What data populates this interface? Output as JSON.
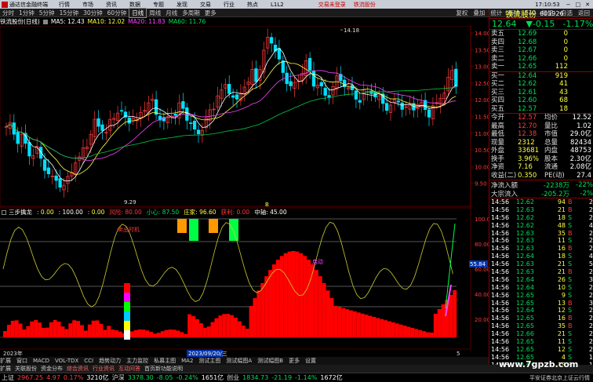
{
  "titlebar": {
    "app_title": "通达信金融终端",
    "menu": [
      "行情",
      "市场",
      "资讯",
      "数据",
      "专题",
      "发现",
      "交易",
      "行业",
      "热点",
      "L1L2"
    ],
    "center_links": [
      "交易未登录",
      "铁流股份"
    ],
    "window_controls": [
      "−",
      "□",
      "✕"
    ]
  },
  "periodbar": {
    "periods": [
      "分时",
      "1分钟",
      "5分钟",
      "15分钟",
      "30分钟",
      "60分钟",
      "日线",
      "周线",
      "月线",
      "多周期",
      "更多"
    ],
    "active_period": "日线",
    "right_tools": [
      "复权",
      "叠加",
      "统计",
      "画线",
      "F10",
      "标记",
      "-自选",
      "返回"
    ]
  },
  "stockline": {
    "name": "铁流股份(日线)",
    "ma5": "MA5: 12.43",
    "ma10": "MA10: 12.02",
    "ma20": "MA20: 11.83",
    "ma60": "MA60: 11.76"
  },
  "price_chart": {
    "high_label": "14.18",
    "low_label": "9.29",
    "right_axis": [
      "14.00",
      "13.50",
      "13.00",
      "12.50",
      "12.00",
      "11.50",
      "11.00",
      "10.50",
      "10.00",
      "9.50"
    ],
    "x_marker": "B"
  },
  "indicator": {
    "name": "三步擒龙",
    "vals": [
      ": 0.00",
      ": 100.00",
      ": 0.00",
      "风险: 80.00",
      "小心: 87.50",
      "庄家: 96.60",
      "获利: 0.00",
      "中轴: 45.00"
    ],
    "annotation_top": "卖出时机",
    "annotation_mid": "启动",
    "value_tag": "55.84",
    "right_axis": [
      "100.00",
      "80.00",
      "60.00",
      "40.00",
      "20.00"
    ]
  },
  "xaxis": {
    "left_date": "2023年",
    "cursor_date": "2023/09/20/三",
    "right_mark": "5"
  },
  "tabs": [
    "扩展",
    "窗口",
    "MACD",
    "VOL-TDX",
    "CCI",
    "趋势动力",
    "主力监控",
    "私募主图",
    "MA2",
    "测试主图",
    "测试幅图A",
    "测试幅图B",
    "更多",
    "设置"
  ],
  "tabs2": [
    "扩展",
    "关联股份",
    "资金分布",
    "综合资讯",
    "行业资讯",
    "互动问答",
    "首页新功能说明"
  ],
  "quote": {
    "name": "铁流股份",
    "code": "603926",
    "price": "12.64",
    "change": "▼-0.15",
    "pct": "-1.17%",
    "asks": [
      {
        "label": "卖五",
        "price": "12.69",
        "vol": "0"
      },
      {
        "label": "卖四",
        "price": "12.68",
        "vol": "0"
      },
      {
        "label": "卖三",
        "price": "12.67",
        "vol": "0"
      },
      {
        "label": "卖二",
        "price": "12.66",
        "vol": "0"
      },
      {
        "label": "卖一",
        "price": "12.65",
        "vol": "112"
      }
    ],
    "bids": [
      {
        "label": "买一",
        "price": "12.64",
        "vol": "919"
      },
      {
        "label": "买二",
        "price": "12.62",
        "vol": "41"
      },
      {
        "label": "买三",
        "price": "12.61",
        "vol": "43"
      },
      {
        "label": "买四",
        "price": "12.60",
        "vol": "68"
      },
      {
        "label": "买五",
        "price": "12.57",
        "vol": "18"
      }
    ],
    "stats": [
      [
        "今开",
        "12.57",
        "均价",
        "12.52"
      ],
      [
        "最高",
        "12.70",
        "量比",
        "1.02"
      ],
      [
        "最低",
        "12.38",
        "市值",
        "29.0亿"
      ],
      [
        "现量",
        "2312",
        "总量",
        "82434"
      ],
      [
        "外盘",
        "33681",
        "内盘",
        "48753"
      ],
      [
        "换手",
        "3.96%",
        "股本",
        "2.30亿"
      ],
      [
        "净资",
        "7.16",
        "流通",
        "2.08亿"
      ],
      [
        "收益(二)",
        "0.350",
        "PE(动)",
        "27.4"
      ]
    ],
    "flow": [
      [
        "净流入额",
        "-2238万",
        "-22%"
      ],
      [
        "大宗流入",
        "-205.2万",
        "-2%"
      ]
    ],
    "ticks": [
      [
        "14:56",
        "12.62",
        "94",
        "B",
        "2"
      ],
      [
        "14:56",
        "12.63",
        "21",
        "B",
        "2"
      ],
      [
        "14:56",
        "12.62",
        "18",
        "S",
        "2"
      ],
      [
        "14:56",
        "12.62",
        "48",
        "S",
        "4"
      ],
      [
        "14:56",
        "12.63",
        "35",
        "B",
        "2"
      ],
      [
        "14:56",
        "12.63",
        "11",
        "S",
        "2"
      ],
      [
        "14:56",
        "12.63",
        "16",
        "B",
        "2"
      ],
      [
        "14:56",
        "12.64",
        "18",
        "S",
        "4"
      ],
      [
        "14:56",
        "12.63",
        "21",
        "S",
        "5"
      ],
      [
        "14:56",
        "12.63",
        "21",
        "B",
        "2"
      ],
      [
        "14:56",
        "12.64",
        "26",
        "S",
        "3"
      ],
      [
        "14:56",
        "12.64",
        "10",
        "S",
        "2"
      ],
      [
        "14:56",
        "12.65",
        "9",
        "S",
        "2"
      ],
      [
        "14:56",
        "12.65",
        "13",
        "B",
        "3"
      ],
      [
        "14:56",
        "12.64",
        "12",
        "S",
        "2"
      ],
      [
        "14:56",
        "12.65",
        "16",
        "B",
        "2"
      ],
      [
        "14:56",
        "12.65",
        "35",
        "B",
        "2"
      ],
      [
        "14:56",
        "12.66",
        "21",
        "S",
        "2"
      ],
      [
        "14:56",
        "12.65",
        "11",
        "S",
        "2"
      ],
      [
        "14:56",
        "12.65",
        "12",
        "S",
        "2"
      ],
      [
        "14:56",
        "12.65",
        "4",
        "S",
        "1"
      ],
      [
        "14:56",
        "12.64",
        "18",
        "S",
        "1"
      ]
    ]
  },
  "status": {
    "sh_label": "上证",
    "sh_val": "2967.25",
    "sh_chg": "4.97",
    "sh_pct": "0.17%",
    "sh_amt": "3210亿",
    "hs_label": "沪深",
    "hs_val": "3378.30",
    "hs_chg": "-8.05",
    "hs_pct": "-0.24%",
    "hs_amt": "1651亿",
    "cy_label": "创业",
    "cy_val": "1834.73",
    "cy_chg": "-21.19",
    "cy_pct": "-1.14%",
    "cy_amt": "1672亿",
    "right_text": "平安证券北京上证云行情",
    "time": "17:10:53",
    "watermark": "www.7gpzb.com"
  },
  "colors": {
    "up": "#ff3b3b",
    "down": "#00e0ff",
    "ma5": "#ffffff",
    "ma10": "#ffff44",
    "ma20": "#ff44ff",
    "ma60": "#00cc44",
    "bg": "#000000"
  }
}
